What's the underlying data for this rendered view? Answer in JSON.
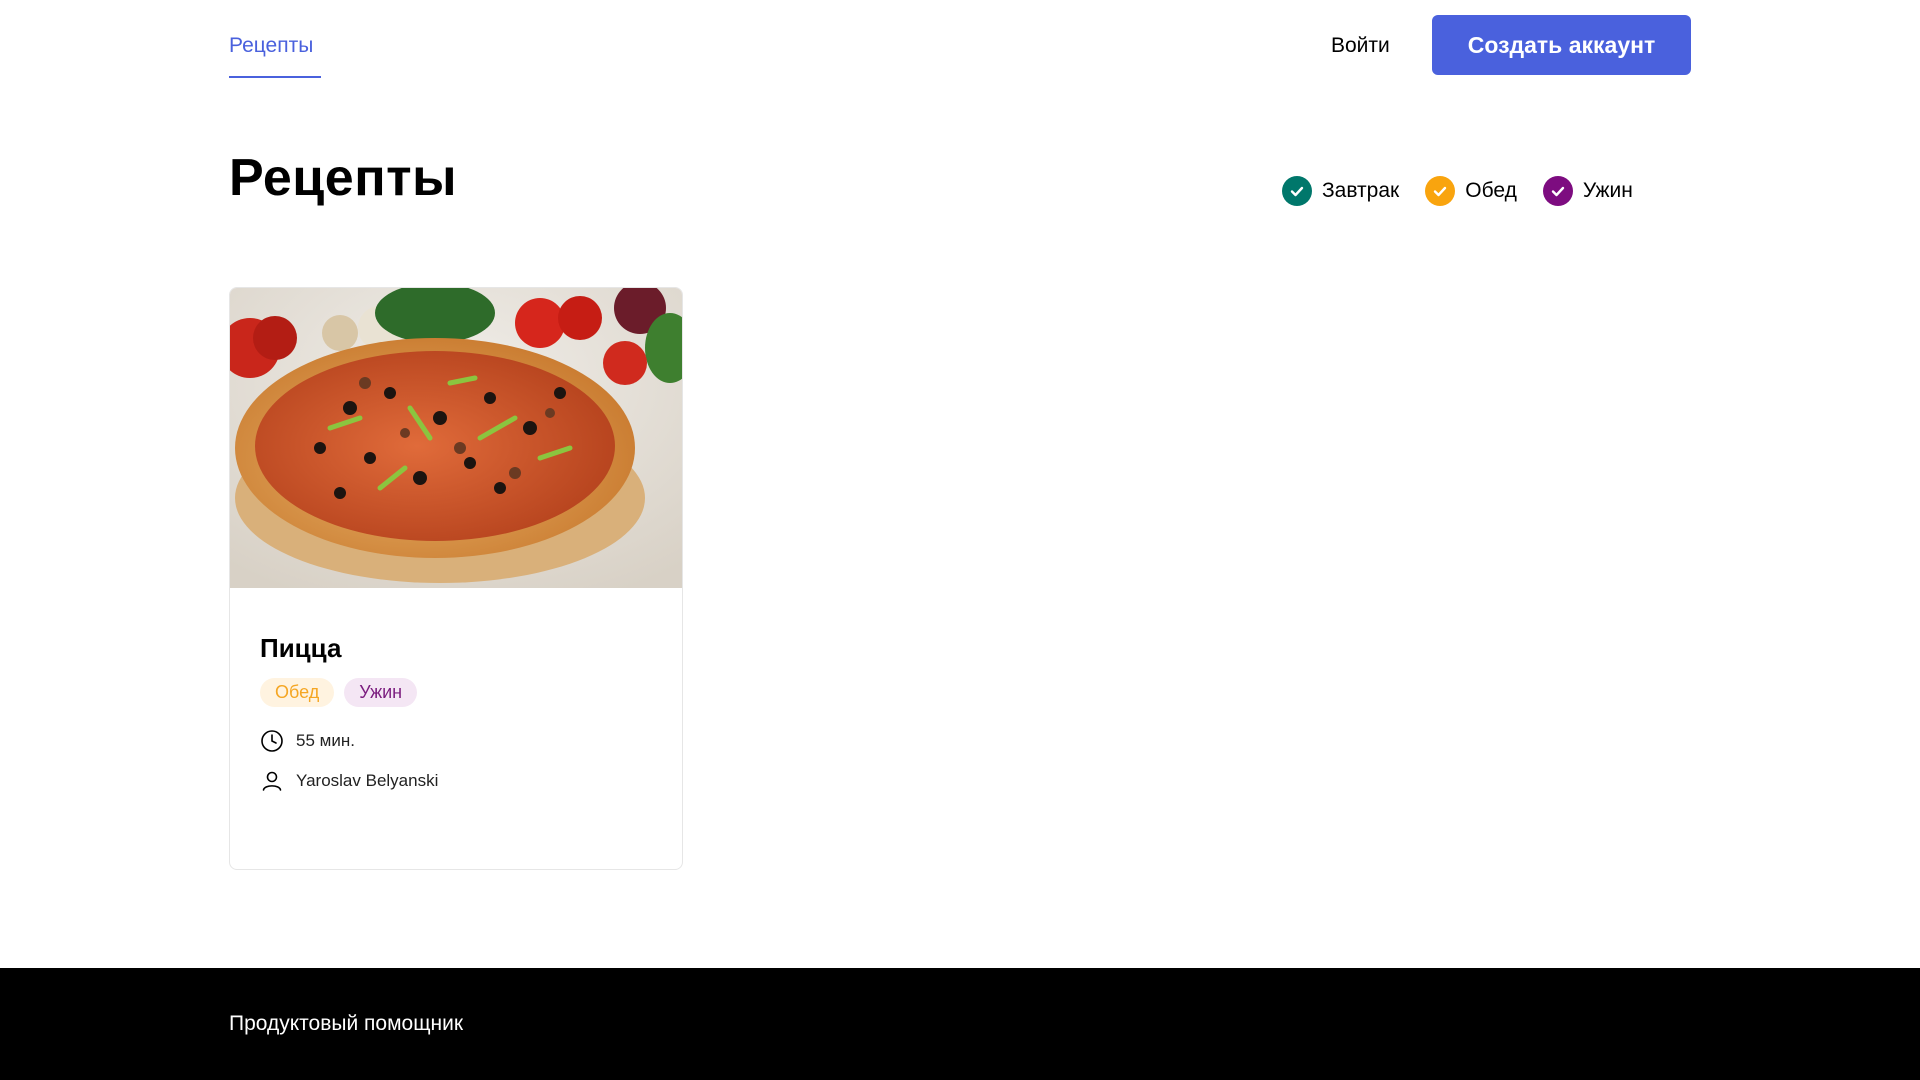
{
  "header": {
    "nav_recipes": "Рецепты",
    "login": "Войти",
    "signup": "Создать аккаунт"
  },
  "page": {
    "title": "Рецепты"
  },
  "filters": [
    {
      "label": "Завтрак",
      "color": "#00776b",
      "icon": "check-icon"
    },
    {
      "label": "Обед",
      "color": "#f9a40e",
      "icon": "check-icon"
    },
    {
      "label": "Ужин",
      "color": "#7d0c80",
      "icon": "check-icon"
    }
  ],
  "recipes": [
    {
      "title": "Пицца",
      "image": "pizza-image",
      "tags": [
        "Обед",
        "Ужин"
      ],
      "time": "55 мин.",
      "author": "Yaroslav Belyanski"
    }
  ],
  "footer": {
    "brand": "Продуктовый помощник"
  },
  "colors": {
    "accent": "#4a61dd",
    "footer_bg": "#000000"
  }
}
